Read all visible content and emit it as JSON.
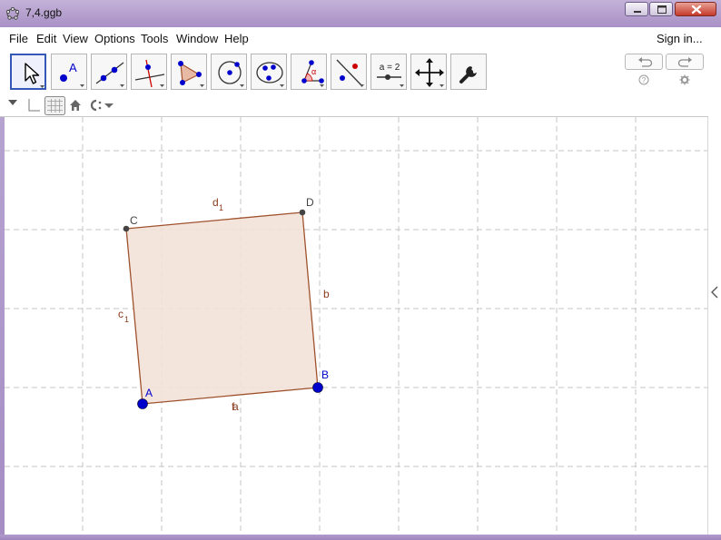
{
  "window": {
    "title": "7,4.ggb",
    "app_icon": "geogebra-icon",
    "controls": [
      "minimize-icon",
      "maximize-icon",
      "close-icon"
    ],
    "frame_color": "#b49fcd",
    "close_color": "#c4392a"
  },
  "menu": {
    "items": [
      "File",
      "Edit",
      "View",
      "Options",
      "Tools",
      "Window",
      "Help"
    ],
    "sign_in": "Sign in..."
  },
  "toolbar": {
    "tools": [
      {
        "name": "move-tool",
        "icon": "cursor-arrow-icon",
        "active": true
      },
      {
        "name": "point-tool",
        "icon": "point-icon",
        "glyph": "A"
      },
      {
        "name": "line-tool",
        "icon": "line-icon"
      },
      {
        "name": "perpendicular-tool",
        "icon": "perpendicular-line-icon"
      },
      {
        "name": "polygon-tool",
        "icon": "polygon-icon"
      },
      {
        "name": "circle-tool",
        "icon": "circle-icon"
      },
      {
        "name": "conic-tool",
        "icon": "ellipse-icon"
      },
      {
        "name": "angle-tool",
        "icon": "angle-icon",
        "glyph": "α"
      },
      {
        "name": "reflect-tool",
        "icon": "reflect-icon"
      },
      {
        "name": "slider-tool",
        "icon": "slider-icon",
        "glyph": "a = 2"
      },
      {
        "name": "move-view-tool",
        "icon": "move-graphics-icon"
      },
      {
        "name": "tools-settings",
        "icon": "wrench-icon"
      }
    ],
    "undo_icon": "undo-icon",
    "redo_icon": "redo-icon",
    "help_icon": "help-icon",
    "settings_icon": "gear-icon",
    "accent_color": "#3557b6"
  },
  "stylebar": {
    "items": [
      "expand-triangle-icon",
      "axes-toggle-icon",
      "grid-toggle-icon",
      "home-view-icon",
      "point-capture-icon"
    ]
  },
  "graphics": {
    "grid": true,
    "grid_style": "dashed",
    "grid_color": "#c4c4c4",
    "polygon_fill": "#f2e1d8",
    "edge_color": "#a0522d",
    "free_point_color": "#0000cc",
    "dependent_point_color": "#444444",
    "points": [
      {
        "label": "A",
        "color": "#0000cc"
      },
      {
        "label": "B",
        "color": "#0000cc"
      },
      {
        "label": "C",
        "color": "#444444"
      },
      {
        "label": "D",
        "color": "#444444"
      }
    ],
    "segments": [
      {
        "name": "a",
        "from": "A",
        "to": "B",
        "label": "a"
      },
      {
        "name": "b",
        "from": "B",
        "to": "D",
        "label": "b"
      },
      {
        "name": "c1",
        "from": "A",
        "to": "C",
        "label": "c",
        "subscript": "1"
      },
      {
        "name": "d1",
        "from": "C",
        "to": "D",
        "label": "d",
        "subscript": "1"
      }
    ],
    "a_label_overlap": "f"
  },
  "sidebar": {
    "toggle_icon": "collapse-left-arrow-icon"
  }
}
